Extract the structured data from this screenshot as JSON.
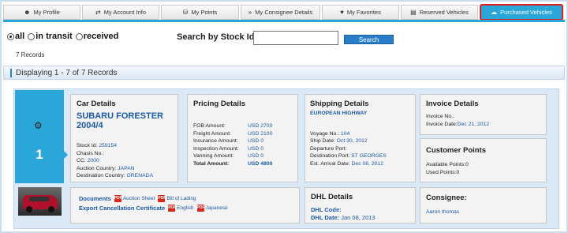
{
  "tabs": [
    {
      "label": "My Profile",
      "icon": "person-icon",
      "active": false
    },
    {
      "label": "My Account Info",
      "icon": "account-icon",
      "active": false
    },
    {
      "label": "My Points",
      "icon": "points-icon",
      "active": false
    },
    {
      "label": "My Consignee Details",
      "icon": "double-chevron-icon",
      "active": false
    },
    {
      "label": "My Favorites",
      "icon": "heart-icon",
      "active": false
    },
    {
      "label": "Reserved Vehicles",
      "icon": "document-icon",
      "active": false
    },
    {
      "label": "Purchased Vehicles",
      "icon": "cloud-icon",
      "active": true
    }
  ],
  "filters": {
    "options": [
      {
        "label": "all",
        "selected": true
      },
      {
        "label": "in transit",
        "selected": false
      },
      {
        "label": "received",
        "selected": false
      }
    ],
    "search_label": "Search by Stock Id",
    "search_value": "",
    "search_button": "Search",
    "records": "7 Records"
  },
  "displaying": "Displaying 1 - 7 of 7 Records",
  "listing": {
    "index": "1",
    "car": {
      "title": "Car Details",
      "name": "SUBARU FORESTER 2004/4",
      "stock_id_label": "Stock Id:",
      "stock_id": "259154",
      "chassis_label": "Chasis No.:",
      "chassis": "",
      "cc_label": "CC:",
      "cc": "2000",
      "auction_country_label": "Auction Country:",
      "auction_country": "JAPAN",
      "destination_country_label": "Destination Country:",
      "destination_country": "GRENADA"
    },
    "pricing": {
      "title": "Pricing Details",
      "rows": [
        {
          "label": "FOB Amount:",
          "value": "USD 2700"
        },
        {
          "label": "Freight Amount:",
          "value": "USD 2100"
        },
        {
          "label": "Insurance Amount:",
          "value": "USD 0"
        },
        {
          "label": "Inspection Amount:",
          "value": "USD 0"
        },
        {
          "label": "Vanning Amount:",
          "value": "USD 0"
        }
      ],
      "total_label": "Total Amount:",
      "total_value": "USD 4800"
    },
    "shipping": {
      "title": "Shipping Details",
      "vessel": "EUROPEAN HIGHWAY",
      "voyage_label": "Voyage No.:",
      "voyage": "104",
      "ship_date_label": "Ship Date:",
      "ship_date": "Oct 30, 2012",
      "departure_label": "Departure Port:",
      "departure": "",
      "destination_label": "Destination Port:",
      "destination": "ST GEORGES",
      "arrival_label": "Est. Arrival Date:",
      "arrival": "Dec 08, 2012"
    },
    "invoice": {
      "title": "Invoice Details",
      "no_label": "Invoice No.:",
      "no": "",
      "date_label": "Invoice Date:",
      "date": "Dec 21, 2012"
    },
    "points": {
      "title": "Customer Points",
      "available_label": "Available Points:",
      "available": "0",
      "used_label": "Used Points:",
      "used": "0"
    },
    "documents": {
      "label": "Documents",
      "auction_sheet": "Auction Sheet",
      "bill_of_lading": "Bill of Lading",
      "export_cert": "Export Cancellation Certificate",
      "english": "English",
      "japanese": "Japanese"
    },
    "dhl": {
      "title": "DHL Details",
      "code_label": "DHL Code:",
      "code": "",
      "date_label": "DHL Date:",
      "date": "Jan 08, 2013"
    },
    "consignee": {
      "title": "Consignee:",
      "name": "Aaron thomas"
    }
  }
}
